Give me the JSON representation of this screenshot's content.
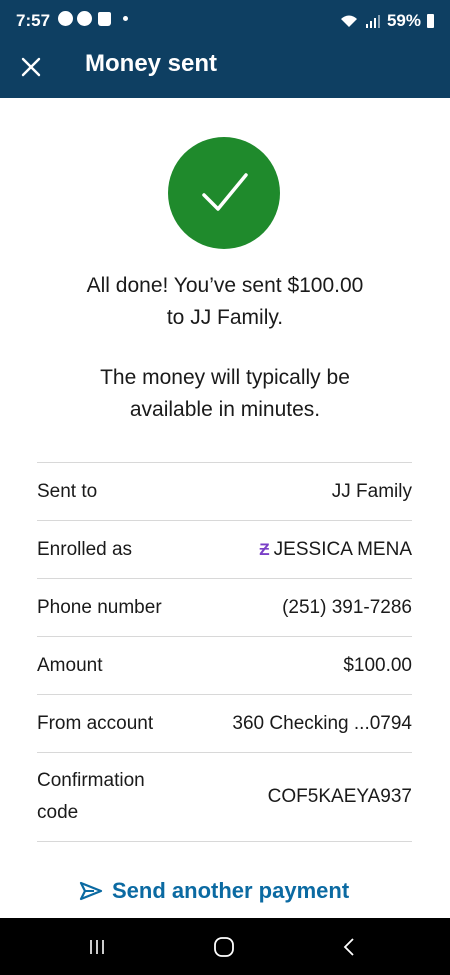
{
  "status_bar": {
    "time": "7:57",
    "battery": "59%"
  },
  "app_bar": {
    "title": "Money sent"
  },
  "confirmation": {
    "headline_line1": "All done! You’ve sent $100.00",
    "headline_line2": "to JJ Family.",
    "note_line1": "The money will typically be",
    "note_line2": "available in minutes."
  },
  "details": {
    "rows": [
      {
        "label": "Sent to",
        "value": "JJ Family"
      },
      {
        "label": "Enrolled as",
        "value": "JESSICA MENA",
        "mark": "Ƶ"
      },
      {
        "label": "Phone number",
        "value": "(251) 391-7286"
      },
      {
        "label": "Amount",
        "value": "$100.00"
      },
      {
        "label": "From account",
        "value": "360 Checking ...0794"
      },
      {
        "label_line1": "Confirmation",
        "label_line2": "code",
        "value": "COF5KAEYA937"
      }
    ]
  },
  "actions": {
    "send_another": "Send another payment"
  },
  "colors": {
    "header": "#0e3f62",
    "success": "#1f8a2c",
    "link": "#0b6aa2",
    "zelle": "#7a3fc7"
  }
}
